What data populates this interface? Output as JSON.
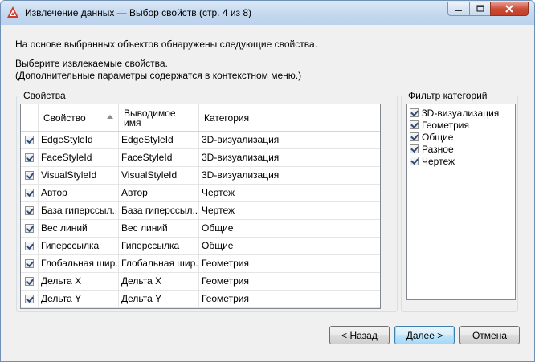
{
  "window": {
    "title": "Извлечение данных — Выбор свойств (стр. 4 из 8)"
  },
  "message": {
    "line1": "На основе выбранных объектов обнаружены следующие свойства.",
    "line2": "Выберите извлекаемые свойства.",
    "line3": "(Дополнительные параметры содержатся в контекстном меню.)"
  },
  "properties_group": {
    "label": "Свойства",
    "columns": [
      "Свойство",
      "Выводимое имя",
      "Категория"
    ],
    "column_head_2_line1": "Выводимое",
    "column_head_2_line2": "имя",
    "rows": [
      {
        "checked": true,
        "property": "EdgeStyleId",
        "display": "EdgeStyleId",
        "category": "3D-визуализация"
      },
      {
        "checked": true,
        "property": "FaceStyleId",
        "display": "FaceStyleId",
        "category": "3D-визуализация"
      },
      {
        "checked": true,
        "property": "VisualStyleId",
        "display": "VisualStyleId",
        "category": "3D-визуализация"
      },
      {
        "checked": true,
        "property": "Автор",
        "display": "Автор",
        "category": "Чертеж"
      },
      {
        "checked": true,
        "property": "База гиперссыл...",
        "display": "База гиперссыл...",
        "category": "Чертеж"
      },
      {
        "checked": true,
        "property": "Вес линий",
        "display": "Вес линий",
        "category": "Общие"
      },
      {
        "checked": true,
        "property": "Гиперссылка",
        "display": "Гиперссылка",
        "category": "Общие"
      },
      {
        "checked": true,
        "property": "Глобальная шир...",
        "display": "Глобальная шир...",
        "category": "Геометрия"
      },
      {
        "checked": true,
        "property": "Дельта X",
        "display": "Дельта X",
        "category": "Геометрия"
      },
      {
        "checked": true,
        "property": "Дельта Y",
        "display": "Дельта Y",
        "category": "Геометрия"
      }
    ]
  },
  "filter_group": {
    "label": "Фильтр категорий",
    "items": [
      {
        "label": "3D-визуализация",
        "checked": true
      },
      {
        "label": "Геометрия",
        "checked": true
      },
      {
        "label": "Общие",
        "checked": true
      },
      {
        "label": "Разное",
        "checked": true
      },
      {
        "label": "Чертеж",
        "checked": true
      }
    ]
  },
  "buttons": {
    "back": "< Назад",
    "next": "Далее >",
    "cancel": "Отмена"
  },
  "icons": {
    "app": "autocad-app-icon",
    "minimize": "minimize-icon",
    "maximize": "maximize-icon",
    "close": "close-icon",
    "sort": "sort-ascending-icon",
    "scroll_up": "scroll-up-icon",
    "scroll_down": "scroll-down-icon"
  },
  "colors": {
    "title_gradient_top": "#dbe8f6",
    "close_button": "#c23d27",
    "default_button": "#bee6fd",
    "app_icon": "#d03b2a"
  }
}
